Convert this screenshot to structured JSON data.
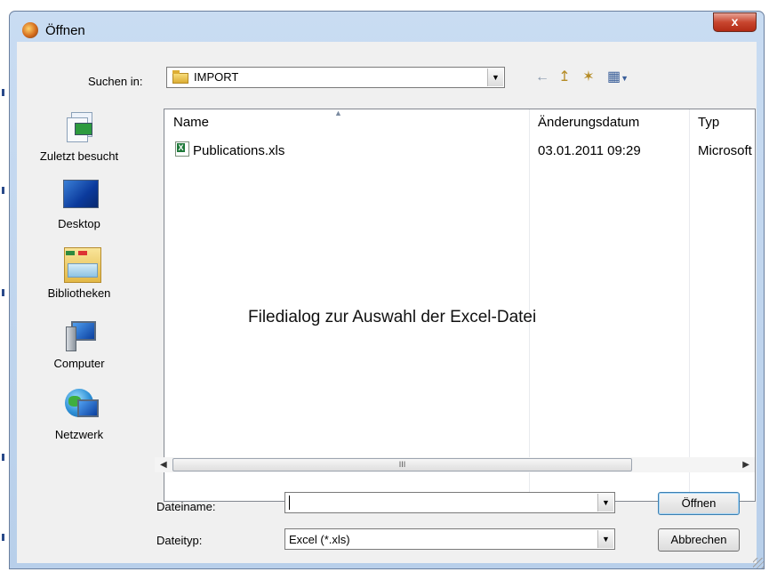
{
  "window": {
    "title": "Öffnen",
    "close_label": "x"
  },
  "lookin": {
    "label": "Suchen in:",
    "value": "IMPORT"
  },
  "toolbar": {
    "back_glyph": "←",
    "up_glyph": "↥",
    "newfolder_glyph": "✶",
    "views_glyph": "▦"
  },
  "places": [
    {
      "label": "Zuletzt besucht",
      "icon": "recent-places-icon"
    },
    {
      "label": "Desktop",
      "icon": "desktop-icon"
    },
    {
      "label": "Bibliotheken",
      "icon": "libraries-icon"
    },
    {
      "label": "Computer",
      "icon": "computer-icon"
    },
    {
      "label": "Netzwerk",
      "icon": "network-icon"
    }
  ],
  "filelist": {
    "columns": [
      "Name",
      "Änderungsdatum",
      "Typ"
    ],
    "rows": [
      {
        "name": "Publications.xls",
        "date": "03.01.2011 09:29",
        "type": "Microsoft"
      }
    ]
  },
  "annotation": "Filedialog zur Auswahl der Excel-Datei",
  "scrollbar": {
    "thumb_glyph": "III"
  },
  "filename": {
    "label": "Dateiname:",
    "value": ""
  },
  "filetype": {
    "label": "Dateityp:",
    "value": "Excel (*.xls)"
  },
  "buttons": {
    "open": "Öffnen",
    "cancel": "Abbrechen"
  }
}
